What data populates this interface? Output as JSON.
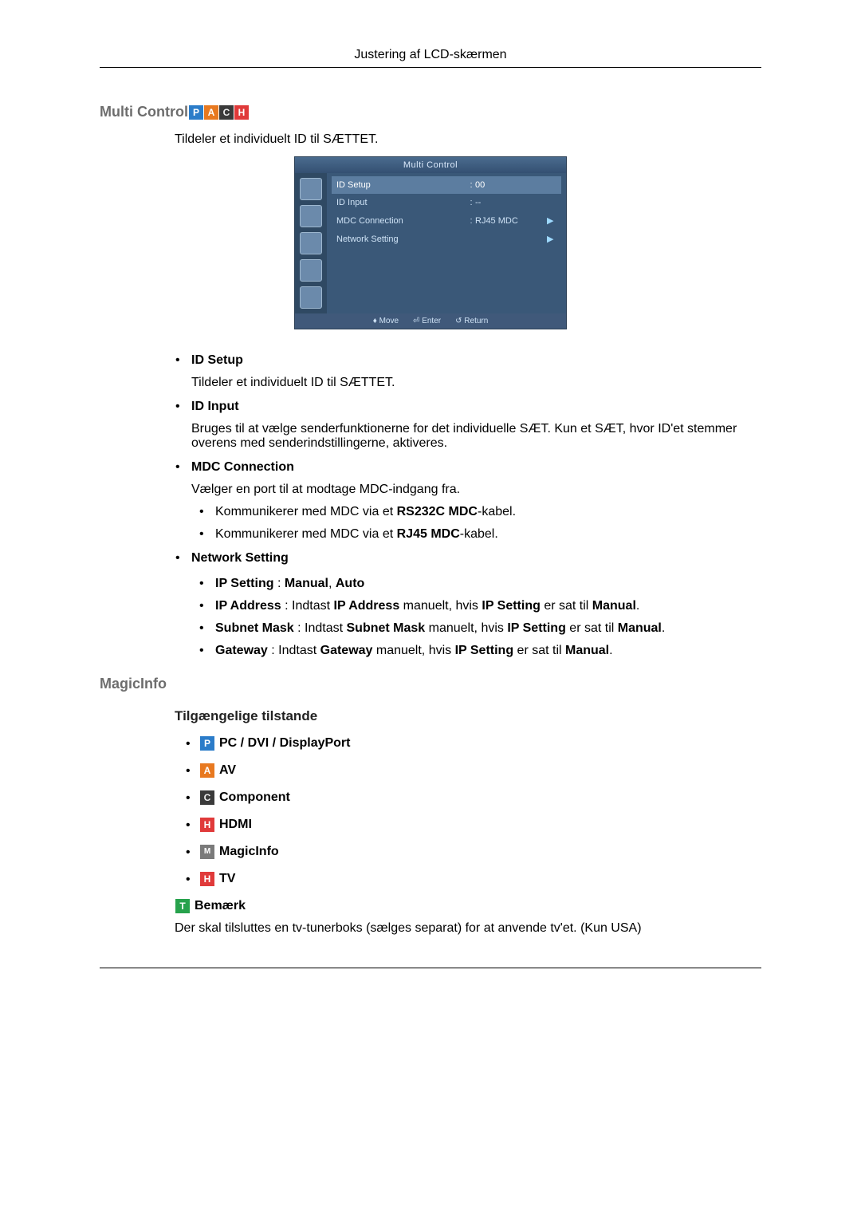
{
  "header": {
    "title": "Justering af LCD-skærmen"
  },
  "section1": {
    "heading": "Multi Control",
    "intro": "Tildeler et individuelt ID til SÆTTET.",
    "osd": {
      "title": "Multi Control",
      "rows": [
        {
          "label": "ID Setup",
          "colon": ":",
          "value": "00",
          "arrow": ""
        },
        {
          "label": "ID Input",
          "colon": ":",
          "value": "--",
          "arrow": ""
        },
        {
          "label": "MDC Connection",
          "colon": ":",
          "value": "RJ45 MDC",
          "arrow": "▶"
        },
        {
          "label": "Network Setting",
          "colon": "",
          "value": "",
          "arrow": "▶"
        }
      ],
      "footer": {
        "move": "Move",
        "enter": "Enter",
        "return": "Return"
      }
    },
    "items": {
      "idsetup": {
        "label": "ID Setup",
        "desc": "Tildeler et individuelt ID til SÆTTET."
      },
      "idinput": {
        "label": "ID Input",
        "desc": "Bruges til at vælge senderfunktionerne for det individuelle SÆT. Kun et SÆT, hvor ID'et stemmer overens med senderindstillingerne, aktiveres."
      },
      "mdc": {
        "label": "MDC Connection",
        "desc": "Vælger en port til at modtage MDC-indgang fra.",
        "sub1_prefix": "Kommunikerer med MDC via et ",
        "sub1_bold": "RS232C MDC",
        "sub1_suffix": "-kabel.",
        "sub2_prefix": "Kommunikerer med MDC via et ",
        "sub2_bold": "RJ45 MDC",
        "sub2_suffix": "-kabel."
      },
      "net": {
        "label": "Network Setting",
        "ip": {
          "b1": "IP Setting",
          "t1": " : ",
          "b2": "Manual",
          "t2": ", ",
          "b3": "Auto"
        },
        "addr": {
          "b1": "IP Address",
          "t1": " : Indtast ",
          "b2": "IP Address",
          "t2": " manuelt, hvis ",
          "b3": "IP Setting",
          "t3": " er sat til ",
          "b4": "Manual",
          "t4": "."
        },
        "subnet": {
          "b1": "Subnet Mask",
          "t1": " : Indtast ",
          "b2": "Subnet Mask",
          "t2": " manuelt, hvis ",
          "b3": "IP Setting",
          "t3": " er sat til ",
          "b4": "Manual",
          "t4": "."
        },
        "gateway": {
          "b1": "Gateway",
          "t1": " : Indtast ",
          "b2": "Gateway",
          "t2": " manuelt, hvis ",
          "b3": "IP Setting",
          "t3": " er sat til ",
          "b4": "Manual",
          "t4": "."
        }
      }
    }
  },
  "section2": {
    "heading": "MagicInfo",
    "subheading": "Tilgængelige tilstande",
    "modes": {
      "pc": "PC / DVI / DisplayPort",
      "av": "AV",
      "comp": "Component",
      "hdmi": "HDMI",
      "magic": "MagicInfo",
      "tv": "TV"
    },
    "note_label": "Bemærk",
    "note_text": "Der skal tilsluttes en tv-tunerboks (sælges separat) for at anvende tv'et. (Kun USA)"
  },
  "chips": {
    "p": "P",
    "a": "A",
    "c": "C",
    "h": "H",
    "m": "M",
    "t": "T"
  }
}
